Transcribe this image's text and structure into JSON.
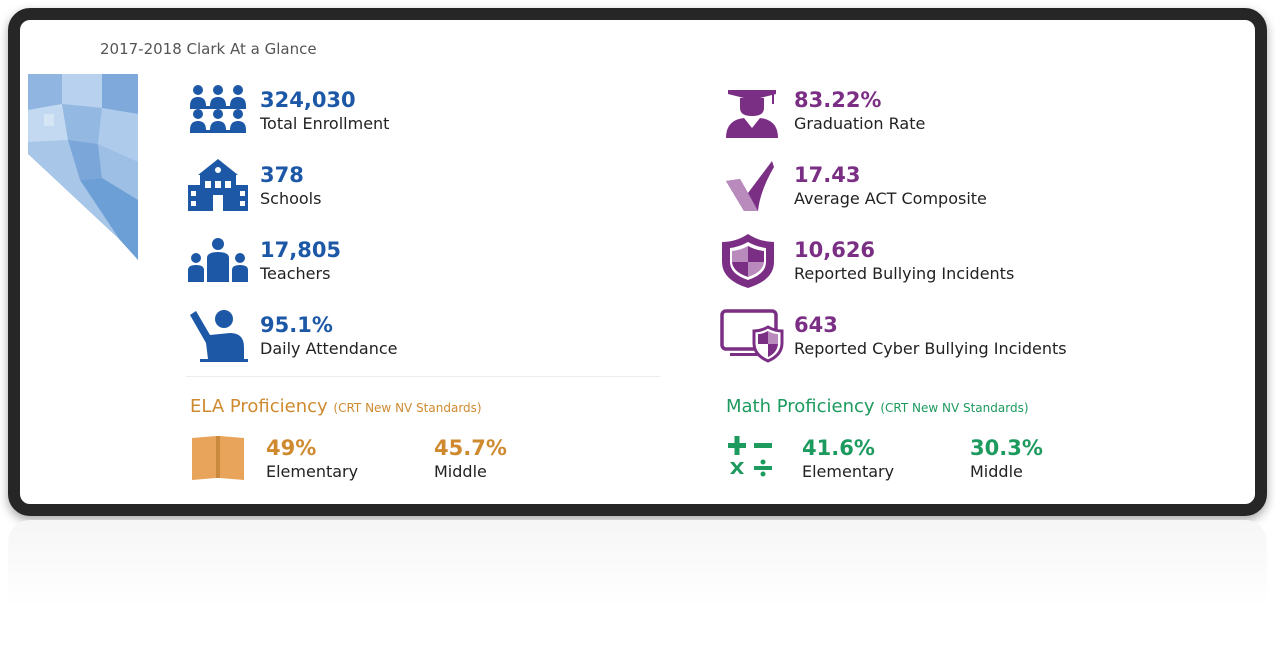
{
  "page": {
    "title": "2017-2018 Clark At a Glance"
  },
  "colors": {
    "blue": "#1d58a7",
    "purple": "#7b2f84",
    "ela": "#cf8a30",
    "math": "#1d9a5e",
    "map_light": "#a8c6e8",
    "map_dark": "#6b9fd6"
  },
  "left_stats": [
    {
      "icon": "students-icon",
      "value": "324,030",
      "label": "Total Enrollment"
    },
    {
      "icon": "school-building-icon",
      "value": "378",
      "label": "Schools"
    },
    {
      "icon": "teachers-icon",
      "value": "17,805",
      "label": "Teachers"
    },
    {
      "icon": "raised-hand-icon",
      "value": "95.1%",
      "label": "Daily Attendance"
    }
  ],
  "right_stats": [
    {
      "icon": "graduation-cap-icon",
      "value": "83.22%",
      "label": "Graduation Rate"
    },
    {
      "icon": "checkmark-icon",
      "value": "17.43",
      "label": "Average ACT Composite"
    },
    {
      "icon": "shield-icon",
      "value": "10,626",
      "label": "Reported Bullying Incidents"
    },
    {
      "icon": "monitor-shield-icon",
      "value": "643",
      "label": "Reported Cyber Bullying Incidents"
    }
  ],
  "ela": {
    "title": "ELA Proficiency",
    "subtitle": "(CRT New NV Standards)",
    "icon": "book-icon",
    "elementary": {
      "value": "49%",
      "label": "Elementary"
    },
    "middle": {
      "value": "45.7%",
      "label": "Middle"
    }
  },
  "math": {
    "title": "Math Proficiency",
    "subtitle": "(CRT New NV Standards)",
    "icon": "math-operators-icon",
    "elementary": {
      "value": "41.6%",
      "label": "Elementary"
    },
    "middle": {
      "value": "30.3%",
      "label": "Middle"
    }
  }
}
